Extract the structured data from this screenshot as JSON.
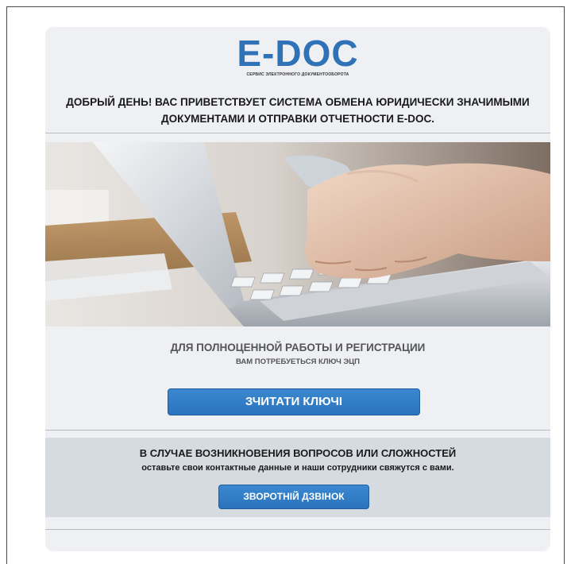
{
  "brand": {
    "logo": "E-DOC",
    "tagline": "СЕРВИС ЭЛЕКТРОННОГО ДОКУМЕНТООБОРОТА"
  },
  "welcome": {
    "line1": "ДОБРЫЙ ДЕНЬ! ВАС ПРИВЕТСТВУЕТ СИСТЕМА ОБМЕНА ЮРИДИЧЕСКИ ЗНАЧИМЫМИ",
    "line2": "ДОКУМЕНТАМИ И ОТПРАВКИ ОТЧЕТНОСТИ E-DOC."
  },
  "register": {
    "title": "ДЛЯ ПОЛНОЦЕННОЙ РАБОТЫ И РЕГИСТРАЦИИ",
    "subtitle": "ВАМ ПОТРЕБУЕТЬСЯ КЛЮЧ ЭЦП",
    "button_label": "ЗЧИТАТИ КЛЮЧІ"
  },
  "support": {
    "title": "В СЛУЧАЕ ВОЗНИКНОВЕНИЯ ВОПРОСОВ ИЛИ СЛОЖНОСТЕЙ",
    "subtitle": "оставьте свои контактные данные и наши сотрудники свяжутся с вами.",
    "button_label": "ЗВОРОТНІЙ ДЗВІНОК"
  },
  "colors": {
    "accent": "#2f72b8",
    "card_background": "#eef0f3",
    "support_background": "#d6dbe1"
  }
}
